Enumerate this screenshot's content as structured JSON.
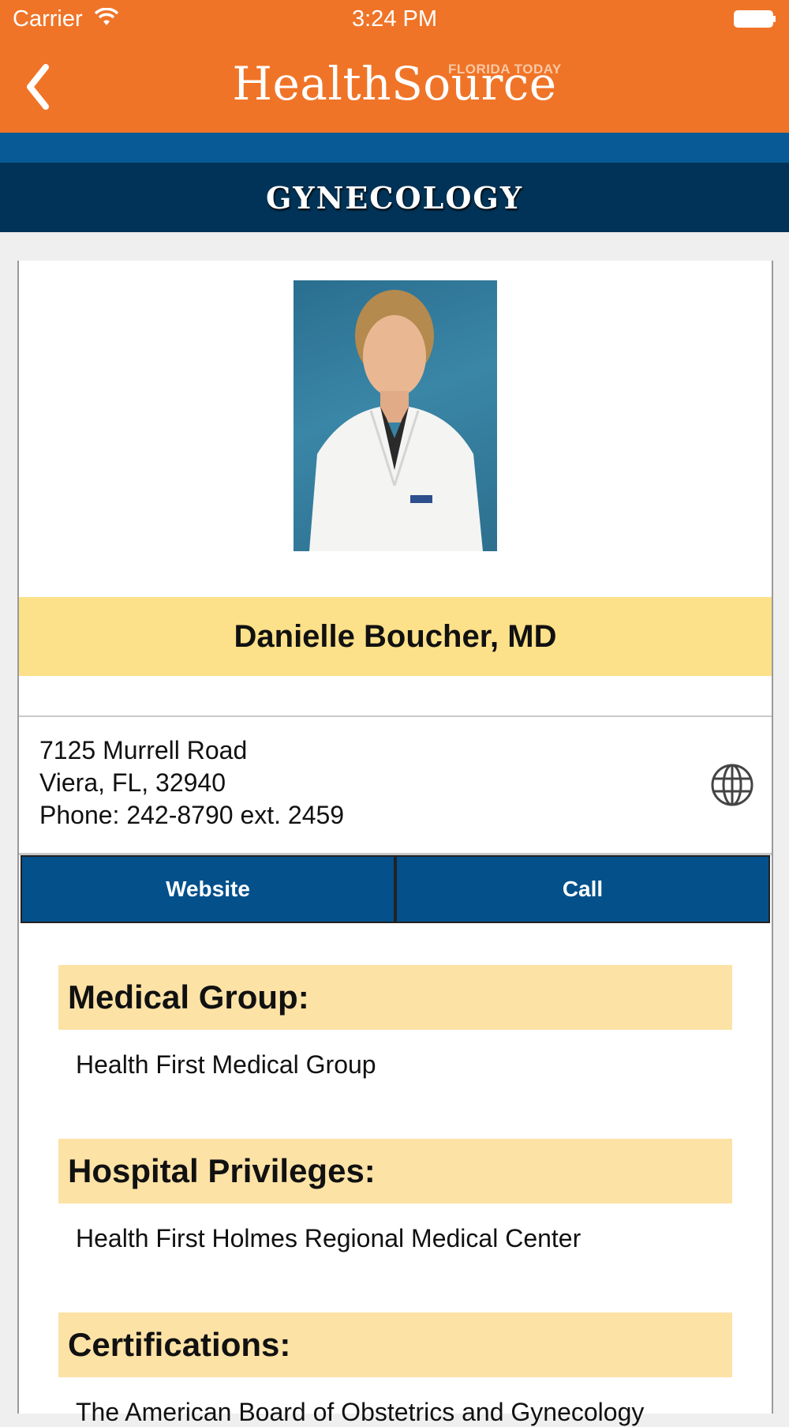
{
  "status_bar": {
    "carrier": "Carrier",
    "time": "3:24 PM"
  },
  "nav": {
    "logo_text": "HealthSource",
    "logo_badge": "FLORIDA TODAY",
    "back_icon": "chevron-left-icon"
  },
  "section": {
    "title": "GYNECOLOGY"
  },
  "doctor": {
    "name": "Danielle Boucher, MD",
    "address_line1": "7125 Murrell Road",
    "address_line2": "Viera, FL, 32940",
    "phone": "Phone: 242-8790 ext. 2459"
  },
  "actions": {
    "website_label": "Website",
    "call_label": "Call"
  },
  "details": [
    {
      "heading": "Medical Group:",
      "value": "Health First Medical Group"
    },
    {
      "heading": "Hospital Privileges:",
      "value": "Health First Holmes Regional Medical Center"
    },
    {
      "heading": "Certifications:",
      "value": "The American Board of Obstetrics and Gynecology"
    }
  ],
  "colors": {
    "orange": "#f07427",
    "navy": "#003357",
    "stripe": "#075a95",
    "button": "#03508b",
    "name_bar": "#fde18a",
    "section_bar": "#fde2a6"
  }
}
